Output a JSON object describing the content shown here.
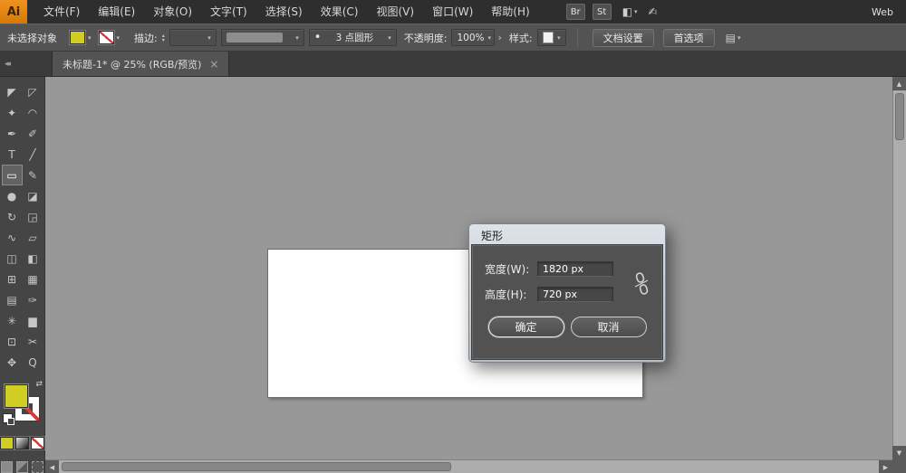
{
  "app": {
    "logo_text": "Ai",
    "workspace_label": "Web"
  },
  "menubar": {
    "items": [
      {
        "name": "file",
        "label": "文件(F)"
      },
      {
        "name": "edit",
        "label": "编辑(E)"
      },
      {
        "name": "object",
        "label": "对象(O)"
      },
      {
        "name": "type",
        "label": "文字(T)"
      },
      {
        "name": "select",
        "label": "选择(S)"
      },
      {
        "name": "effect",
        "label": "效果(C)"
      },
      {
        "name": "view",
        "label": "视图(V)"
      },
      {
        "name": "window",
        "label": "窗口(W)"
      },
      {
        "name": "help",
        "label": "帮助(H)"
      }
    ],
    "bridge_label": "Br",
    "stock_label": "St"
  },
  "controlbar": {
    "status_text": "未选择对象",
    "stroke_label": "描边:",
    "brush_bullet": "•",
    "brush_value": "3 点圆形",
    "opacity_label": "不透明度:",
    "opacity_value": "100%",
    "style_label": "样式:",
    "document_setup_label": "文档设置",
    "preferences_label": "首选项"
  },
  "tabbar": {
    "active_tab": "未标题-1* @ 25% (RGB/预览)",
    "close_glyph": "×",
    "collapse_glyph": "◂◂"
  },
  "toolbar": {
    "tools": [
      {
        "name": "selection",
        "glyph": "◤",
        "selected": false
      },
      {
        "name": "direct-selection",
        "glyph": "◸",
        "selected": false
      },
      {
        "name": "magic-wand",
        "glyph": "✦",
        "selected": false
      },
      {
        "name": "lasso",
        "glyph": "◠",
        "selected": false
      },
      {
        "name": "pen",
        "glyph": "✒",
        "selected": false
      },
      {
        "name": "paintbrush",
        "glyph": "✐",
        "selected": false
      },
      {
        "name": "type",
        "glyph": "T",
        "selected": false
      },
      {
        "name": "line-segment",
        "glyph": "╱",
        "selected": false
      },
      {
        "name": "rectangle",
        "glyph": "▭",
        "selected": true
      },
      {
        "name": "pencil",
        "glyph": "✎",
        "selected": false
      },
      {
        "name": "blob-brush",
        "glyph": "●",
        "selected": false
      },
      {
        "name": "eraser",
        "glyph": "◪",
        "selected": false
      },
      {
        "name": "rotate",
        "glyph": "↻",
        "selected": false
      },
      {
        "name": "scale",
        "glyph": "◲",
        "selected": false
      },
      {
        "name": "width",
        "glyph": "∿",
        "selected": false
      },
      {
        "name": "free-transform",
        "glyph": "▱",
        "selected": false
      },
      {
        "name": "shape-builder",
        "glyph": "◫",
        "selected": false
      },
      {
        "name": "live-paint-bucket",
        "glyph": "◧",
        "selected": false
      },
      {
        "name": "perspective-grid",
        "glyph": "⊞",
        "selected": false
      },
      {
        "name": "mesh",
        "glyph": "▦",
        "selected": false
      },
      {
        "name": "gradient",
        "glyph": "▤",
        "selected": false
      },
      {
        "name": "eyedropper",
        "glyph": "✑",
        "selected": false
      },
      {
        "name": "symbol-sprayer",
        "glyph": "✳",
        "selected": false
      },
      {
        "name": "column-graph",
        "glyph": "▆",
        "selected": false
      },
      {
        "name": "artboard",
        "glyph": "⊡",
        "selected": false
      },
      {
        "name": "slice",
        "glyph": "✂",
        "selected": false
      },
      {
        "name": "hand",
        "glyph": "✥",
        "selected": false
      },
      {
        "name": "zoom",
        "glyph": "Q",
        "selected": false
      }
    ]
  },
  "dialog": {
    "title": "矩形",
    "width_label": "宽度(W):",
    "width_value": "1820 px",
    "height_label": "高度(H):",
    "height_value": "720 px",
    "ok_label": "确定",
    "cancel_label": "取消"
  },
  "icons": {
    "dropdown": "▾",
    "spinner_up": "▴",
    "spinner_down": "▾",
    "chevron_right": "›",
    "scroll_up": "▲",
    "scroll_down": "▼",
    "scroll_left": "◀",
    "scroll_right": "▶",
    "swap": "⇄",
    "arrange": "◧",
    "gesture": "✍",
    "panel": "▤"
  },
  "colors": {
    "fill_swatch": "#d0cd24",
    "none_red": "#d23c3c",
    "canvas_bg": "#989898",
    "artboard_bg": "#ffffff",
    "logo_orange": "#e0821e"
  }
}
